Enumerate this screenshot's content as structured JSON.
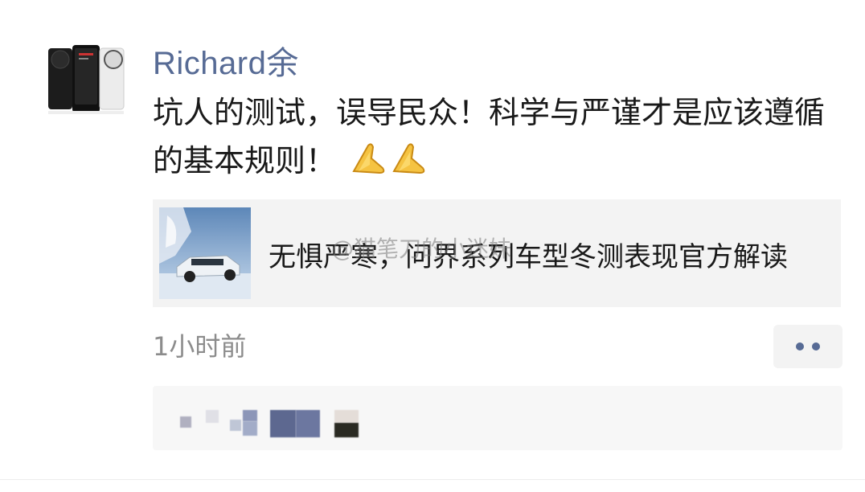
{
  "post": {
    "username": "Richard余",
    "text": "坑人的测试，误导民众！科学与严谨才是应该遵循的基本规则！",
    "emoji": "praying-hands",
    "timestamp": "1小时前"
  },
  "link_card": {
    "title": "无惧严寒，问界系列车型冬测表现官方解读"
  },
  "watermark": "@猫笔刀的小迷妹",
  "icons": {
    "more": "more-dots-icon"
  },
  "colors": {
    "name_blue": "#576b95",
    "text": "#191919",
    "time_gray": "#8c8c8c",
    "card_bg": "#f3f3f3"
  }
}
